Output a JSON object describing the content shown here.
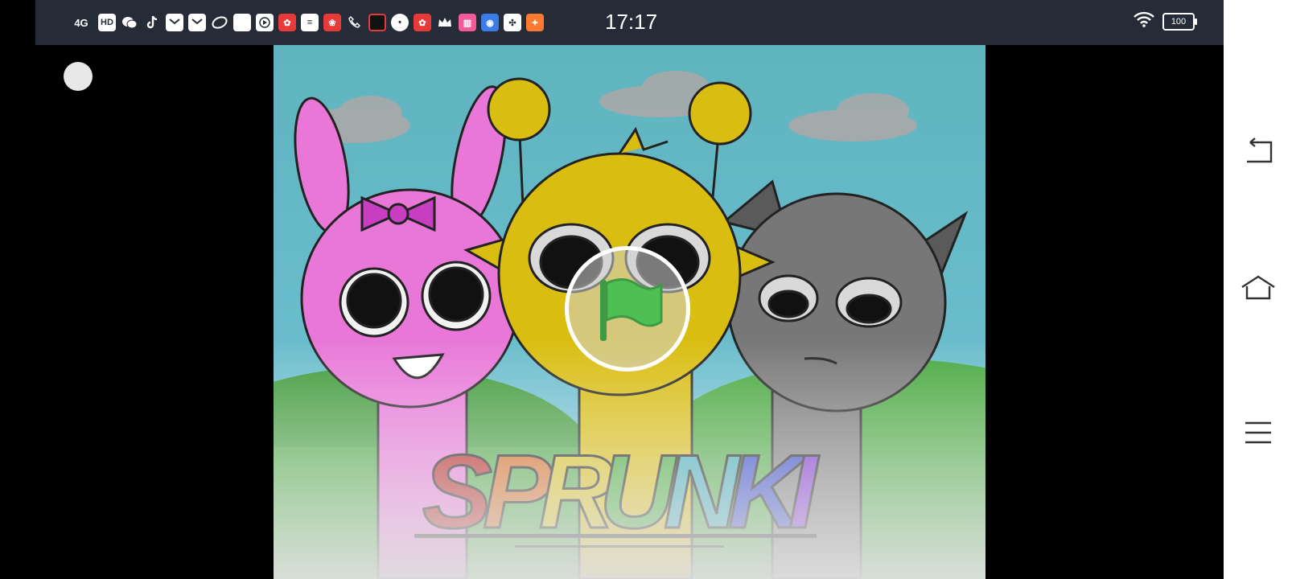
{
  "status_bar": {
    "network": "4G",
    "time": "17:17",
    "battery": "100",
    "notification_icons": [
      "network-4g-icon",
      "hd-icon",
      "wechat-icon",
      "tiktok-icon",
      "mail-icon",
      "mail-icon",
      "app-icon",
      "app-icon",
      "play-icon",
      "app-icon",
      "app-icon",
      "app-icon",
      "phone-icon",
      "app-icon",
      "app-icon",
      "app-icon",
      "crown-icon",
      "app-icon",
      "app-icon",
      "app-icon",
      "app-icon"
    ]
  },
  "game": {
    "title_letters": [
      "S",
      "P",
      "R",
      "U",
      "N",
      "K",
      "I"
    ],
    "title_colors": [
      "#b51a1a",
      "#d4671b",
      "#d8c21b",
      "#3caa32",
      "#39a9b7",
      "#2a3fc8",
      "#7a2ad0"
    ],
    "start_icon": "green-flag-icon",
    "characters": [
      "pink-bunny",
      "yellow-antenna",
      "gray-cat"
    ]
  },
  "nav": {
    "buttons": [
      "back-icon",
      "home-icon",
      "menu-icon"
    ]
  },
  "colors": {
    "status_bg": "#252b37",
    "flag_green": "#4dbf53",
    "sky": "#61b7c4"
  }
}
